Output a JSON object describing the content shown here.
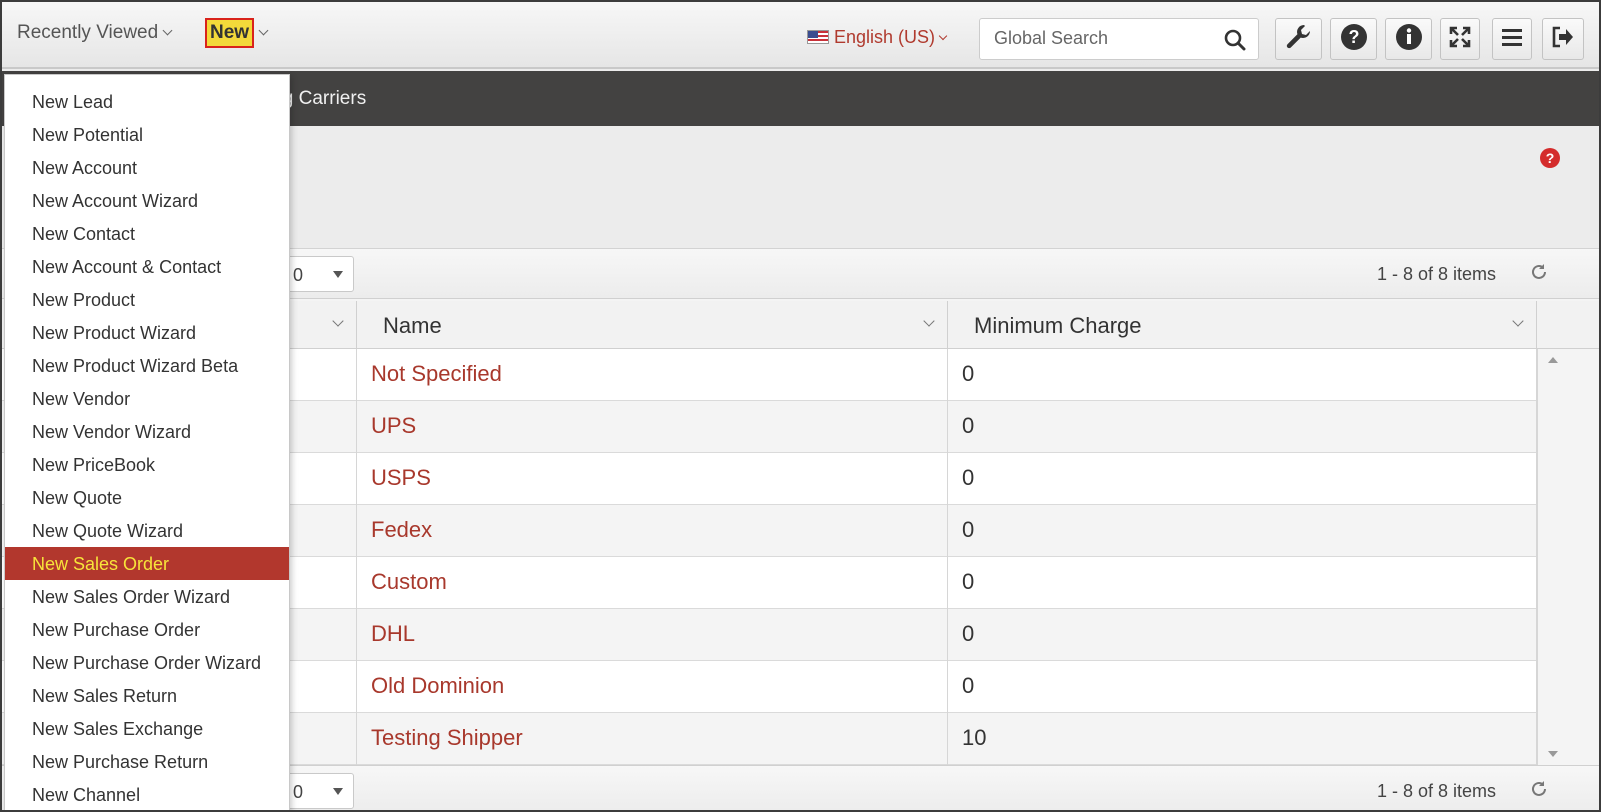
{
  "topbar": {
    "recently_viewed": "Recently Viewed",
    "new_label": "New",
    "language": "English (US)",
    "search_placeholder": "Global Search"
  },
  "nav": {
    "strip_text": "ing Carriers"
  },
  "pager": {
    "page_size": "0",
    "info": "1 - 8 of 8 items"
  },
  "grid": {
    "columns": [
      "Name",
      "Minimum Charge"
    ],
    "rows": [
      {
        "name": "Not Specified",
        "min": "0"
      },
      {
        "name": "UPS",
        "min": "0"
      },
      {
        "name": "USPS",
        "min": "0"
      },
      {
        "name": "Fedex",
        "min": "0"
      },
      {
        "name": "Custom",
        "min": "0"
      },
      {
        "name": "DHL",
        "min": "0"
      },
      {
        "name": "Old Dominion",
        "min": "0"
      },
      {
        "name": "Testing Shipper",
        "min": "10"
      }
    ]
  },
  "new_menu": {
    "items": [
      "New Lead",
      "New Potential",
      "New Account",
      "New Account Wizard",
      "New Contact",
      "New Account & Contact",
      "New Product",
      "New Product Wizard",
      "New Product Wizard Beta",
      "New Vendor",
      "New Vendor Wizard",
      "New PriceBook",
      "New Quote",
      "New Quote Wizard",
      "New Sales Order",
      "New Sales Order Wizard",
      "New Purchase Order",
      "New Purchase Order Wizard",
      "New Sales Return",
      "New Sales Exchange",
      "New Purchase Return",
      "New Channel"
    ],
    "active_item": "New Sales Order"
  },
  "colors": {
    "accent_red": "#b2372d",
    "highlight_yellow": "#f3d93a",
    "link_red": "#a8382c",
    "nav_dark": "#434241"
  },
  "icons": [
    "chevron-down-icon",
    "search-icon",
    "wrench-icon",
    "help-icon",
    "info-icon",
    "fullscreen-icon",
    "menu-icon",
    "logout-icon",
    "refresh-icon",
    "help-red-icon",
    "flag-us-icon"
  ]
}
